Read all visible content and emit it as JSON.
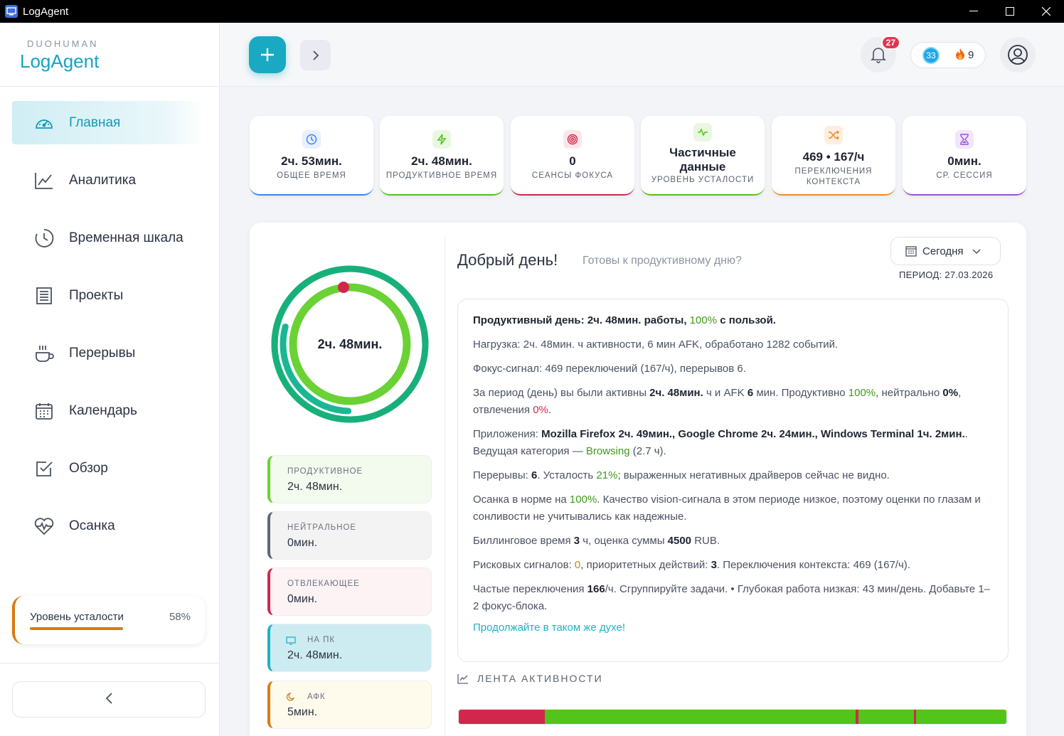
{
  "window": {
    "title": "LogAgent",
    "minimize": "—",
    "maximize": "☐",
    "close": "✕"
  },
  "brand": {
    "small": "DUOHUMAN",
    "big": "LogAgent"
  },
  "nav": [
    {
      "label": "Главная",
      "icon": "gauge-icon",
      "active": true
    },
    {
      "label": "Аналитика",
      "icon": "chart-line-icon"
    },
    {
      "label": "Временная шкала",
      "icon": "clock-icon"
    },
    {
      "label": "Проекты",
      "icon": "document-icon"
    },
    {
      "label": "Перерывы",
      "icon": "coffee-icon"
    },
    {
      "label": "Календарь",
      "icon": "calendar-icon"
    },
    {
      "label": "Обзор",
      "icon": "checkbox-icon"
    },
    {
      "label": "Осанка",
      "icon": "heart-pulse-icon"
    }
  ],
  "fatigue": {
    "label": "Уровень усталости",
    "percent": "58%",
    "accent": "#d97a10"
  },
  "header": {
    "notifications": "27",
    "coins": "33",
    "streak": "9"
  },
  "stats": [
    {
      "value": "2ч. 53мин.",
      "caption": "ОБЩЕЕ ВРЕМЯ",
      "icon": "clock-icon",
      "color": "#3b82f6"
    },
    {
      "value": "2ч. 48мин.",
      "caption": "ПРОДУКТИВНОЕ ВРЕМЯ",
      "icon": "bolt-icon",
      "color": "#52c41a"
    },
    {
      "value": "0",
      "caption": "СЕАНСЫ ФОКУСА",
      "icon": "target-icon",
      "color": "#d0284d"
    },
    {
      "value": "Частичные данные",
      "caption": "УРОВЕНЬ УСТАЛОСТИ",
      "icon": "activity-icon",
      "color": "#52c41a"
    },
    {
      "value": "469 • 167/ч",
      "caption": "ПЕРЕКЛЮЧЕНИЯ КОНТЕКСТА",
      "icon": "shuffle-icon",
      "color": "#f28c28"
    },
    {
      "value": "0мин.",
      "caption": "СР. СЕССИЯ",
      "icon": "hourglass-icon",
      "color": "#9b51e0"
    }
  ],
  "ring": {
    "label": "2ч. 48мин."
  },
  "categories": [
    {
      "label": "ПРОДУКТИВНОЕ",
      "value": "2ч. 48мин.",
      "color": "#6ad234"
    },
    {
      "label": "НЕЙТРАЛЬНОЕ",
      "value": "0мин.",
      "color": "#5f6673"
    },
    {
      "label": "ОТВЛЕКАЮЩЕЕ",
      "value": "0мин.",
      "color": "#d0284d"
    },
    {
      "label": "НА ПК",
      "value": "2ч. 48мин.",
      "color": "#22b1c6"
    },
    {
      "label": "АФК",
      "value": "5мин.",
      "color": "#d97a10"
    }
  ],
  "greeting": {
    "title": "Добрый день!",
    "subtitle": "Готовы к продуктивному дню?"
  },
  "period": {
    "button": "Сегодня",
    "label": "ПЕРИОД: 27.03.2026"
  },
  "summary": {
    "p1": {
      "a": "Продуктивный день: ",
      "b": "2ч. 48мин.",
      "c": " работы, ",
      "d": "100%",
      "e": " с пользой."
    },
    "p2": "Нагрузка: 2ч. 48мин. ч активности, 6 мин AFK, обработано 1282 событий.",
    "p3": "Фокус-сигнал: 469 переключений (167/ч), перерывов 6.",
    "p4": {
      "a": "За период (день) вы были активны ",
      "b": "2ч. 48мин.",
      "c": " ч и AFK ",
      "d": "6",
      "e": " мин. Продуктивно ",
      "f": "100%",
      "g": ", нейтрально ",
      "h": "0%",
      "i": ", отвлечения ",
      "j": "0%",
      "k": "."
    },
    "p5": {
      "a": "Приложения: ",
      "b": "Mozilla Firefox 2ч. 49мин., Google Chrome 2ч. 24мин., Windows Terminal 1ч. 2мин.",
      "c": ". Ведущая категория — ",
      "d": "Browsing",
      "e": " (2.7 ч)."
    },
    "p6": {
      "a": "Перерывы: ",
      "b": "6",
      "c": ". Усталость ",
      "d": "21%",
      "e": "; выраженных негативных драйверов сейчас не видно."
    },
    "p7": {
      "a": "Осанка в норме на ",
      "b": "100%",
      "c": ". Качество vision-сигнала в этом периоде низкое, поэтому оценки по глазам и сонливости не учитывались как надежные."
    },
    "p8": {
      "a": "Биллинговое время ",
      "b": "3",
      "c": " ч, оценка суммы ",
      "d": "4500",
      "e": " RUB."
    },
    "p9": {
      "a": "Рисковых сигналов: ",
      "b": "0",
      "c": ", приоритетных действий: ",
      "d": "3",
      "e": ". Переключения контекста: 469 (167/ч)."
    },
    "p10": {
      "a": "Частые переключения ",
      "b": "166",
      "c": "/ч. Сгруппируйте задачи. • Глубокая работа низкая: 43 мин/день. Добавьте 1–2 фокус-блока."
    },
    "p11": "Продолжайте в таком же духе!"
  },
  "feed": {
    "title": "ЛЕНТА АКТИВНОСТИ"
  }
}
